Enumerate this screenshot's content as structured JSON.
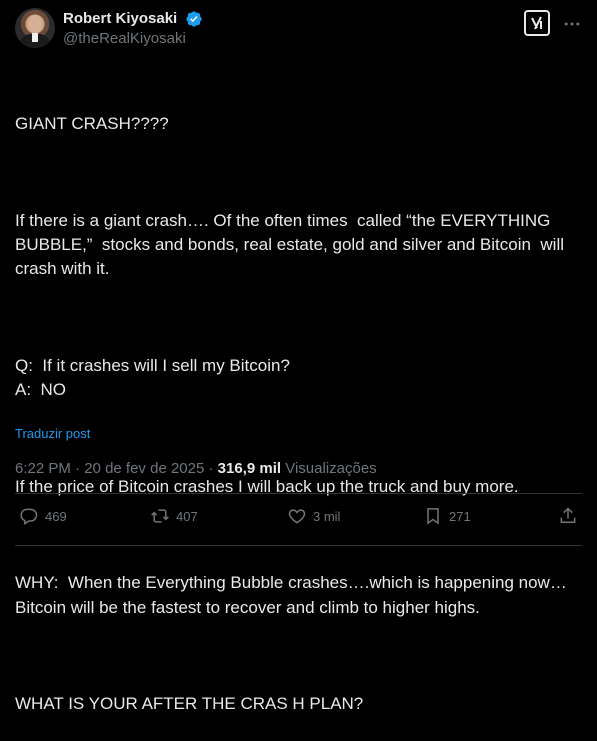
{
  "author": {
    "name": "Robert Kiyosaki",
    "handle": "@theRealKiyosaki"
  },
  "icons": {
    "verified": "verified-badge-icon",
    "grok": "grok-icon",
    "more": "more-icon",
    "reply": "reply-icon",
    "retweet": "retweet-icon",
    "like": "like-icon",
    "bookmark": "bookmark-icon",
    "share": "share-icon"
  },
  "colors": {
    "background": "#000000",
    "text": "#e7e9ea",
    "muted": "#71767b",
    "link": "#1d9bf0",
    "verified": "#1d9bf0"
  },
  "tweet": {
    "paragraphs": [
      "GIANT CRASH????",
      "If there is a giant crash…. Of the often times  called “the EVERYTHING BUBBLE,”  stocks and bonds, real estate, gold and silver and Bitcoin  will crash with it.",
      "Q:  If it crashes will I sell my Bitcoin?\nA:  NO",
      "If the price of Bitcoin crashes I will back up the truck and buy more.",
      "WHY:  When the Everything Bubble crashes….which is happening now…Bitcoin will be the fastest to recover and climb to higher highs.",
      "WHAT IS YOUR AFTER THE CRAS H PLAN?"
    ],
    "translate_label": "Traduzir post",
    "time": "6:22 PM",
    "date": "20 de fev de 2025",
    "separator": "·",
    "views_count": "316,9 mil",
    "views_label": "Visualizações"
  },
  "actions": {
    "replies": "469",
    "retweets": "407",
    "likes": "3 mil",
    "bookmarks": "271"
  }
}
